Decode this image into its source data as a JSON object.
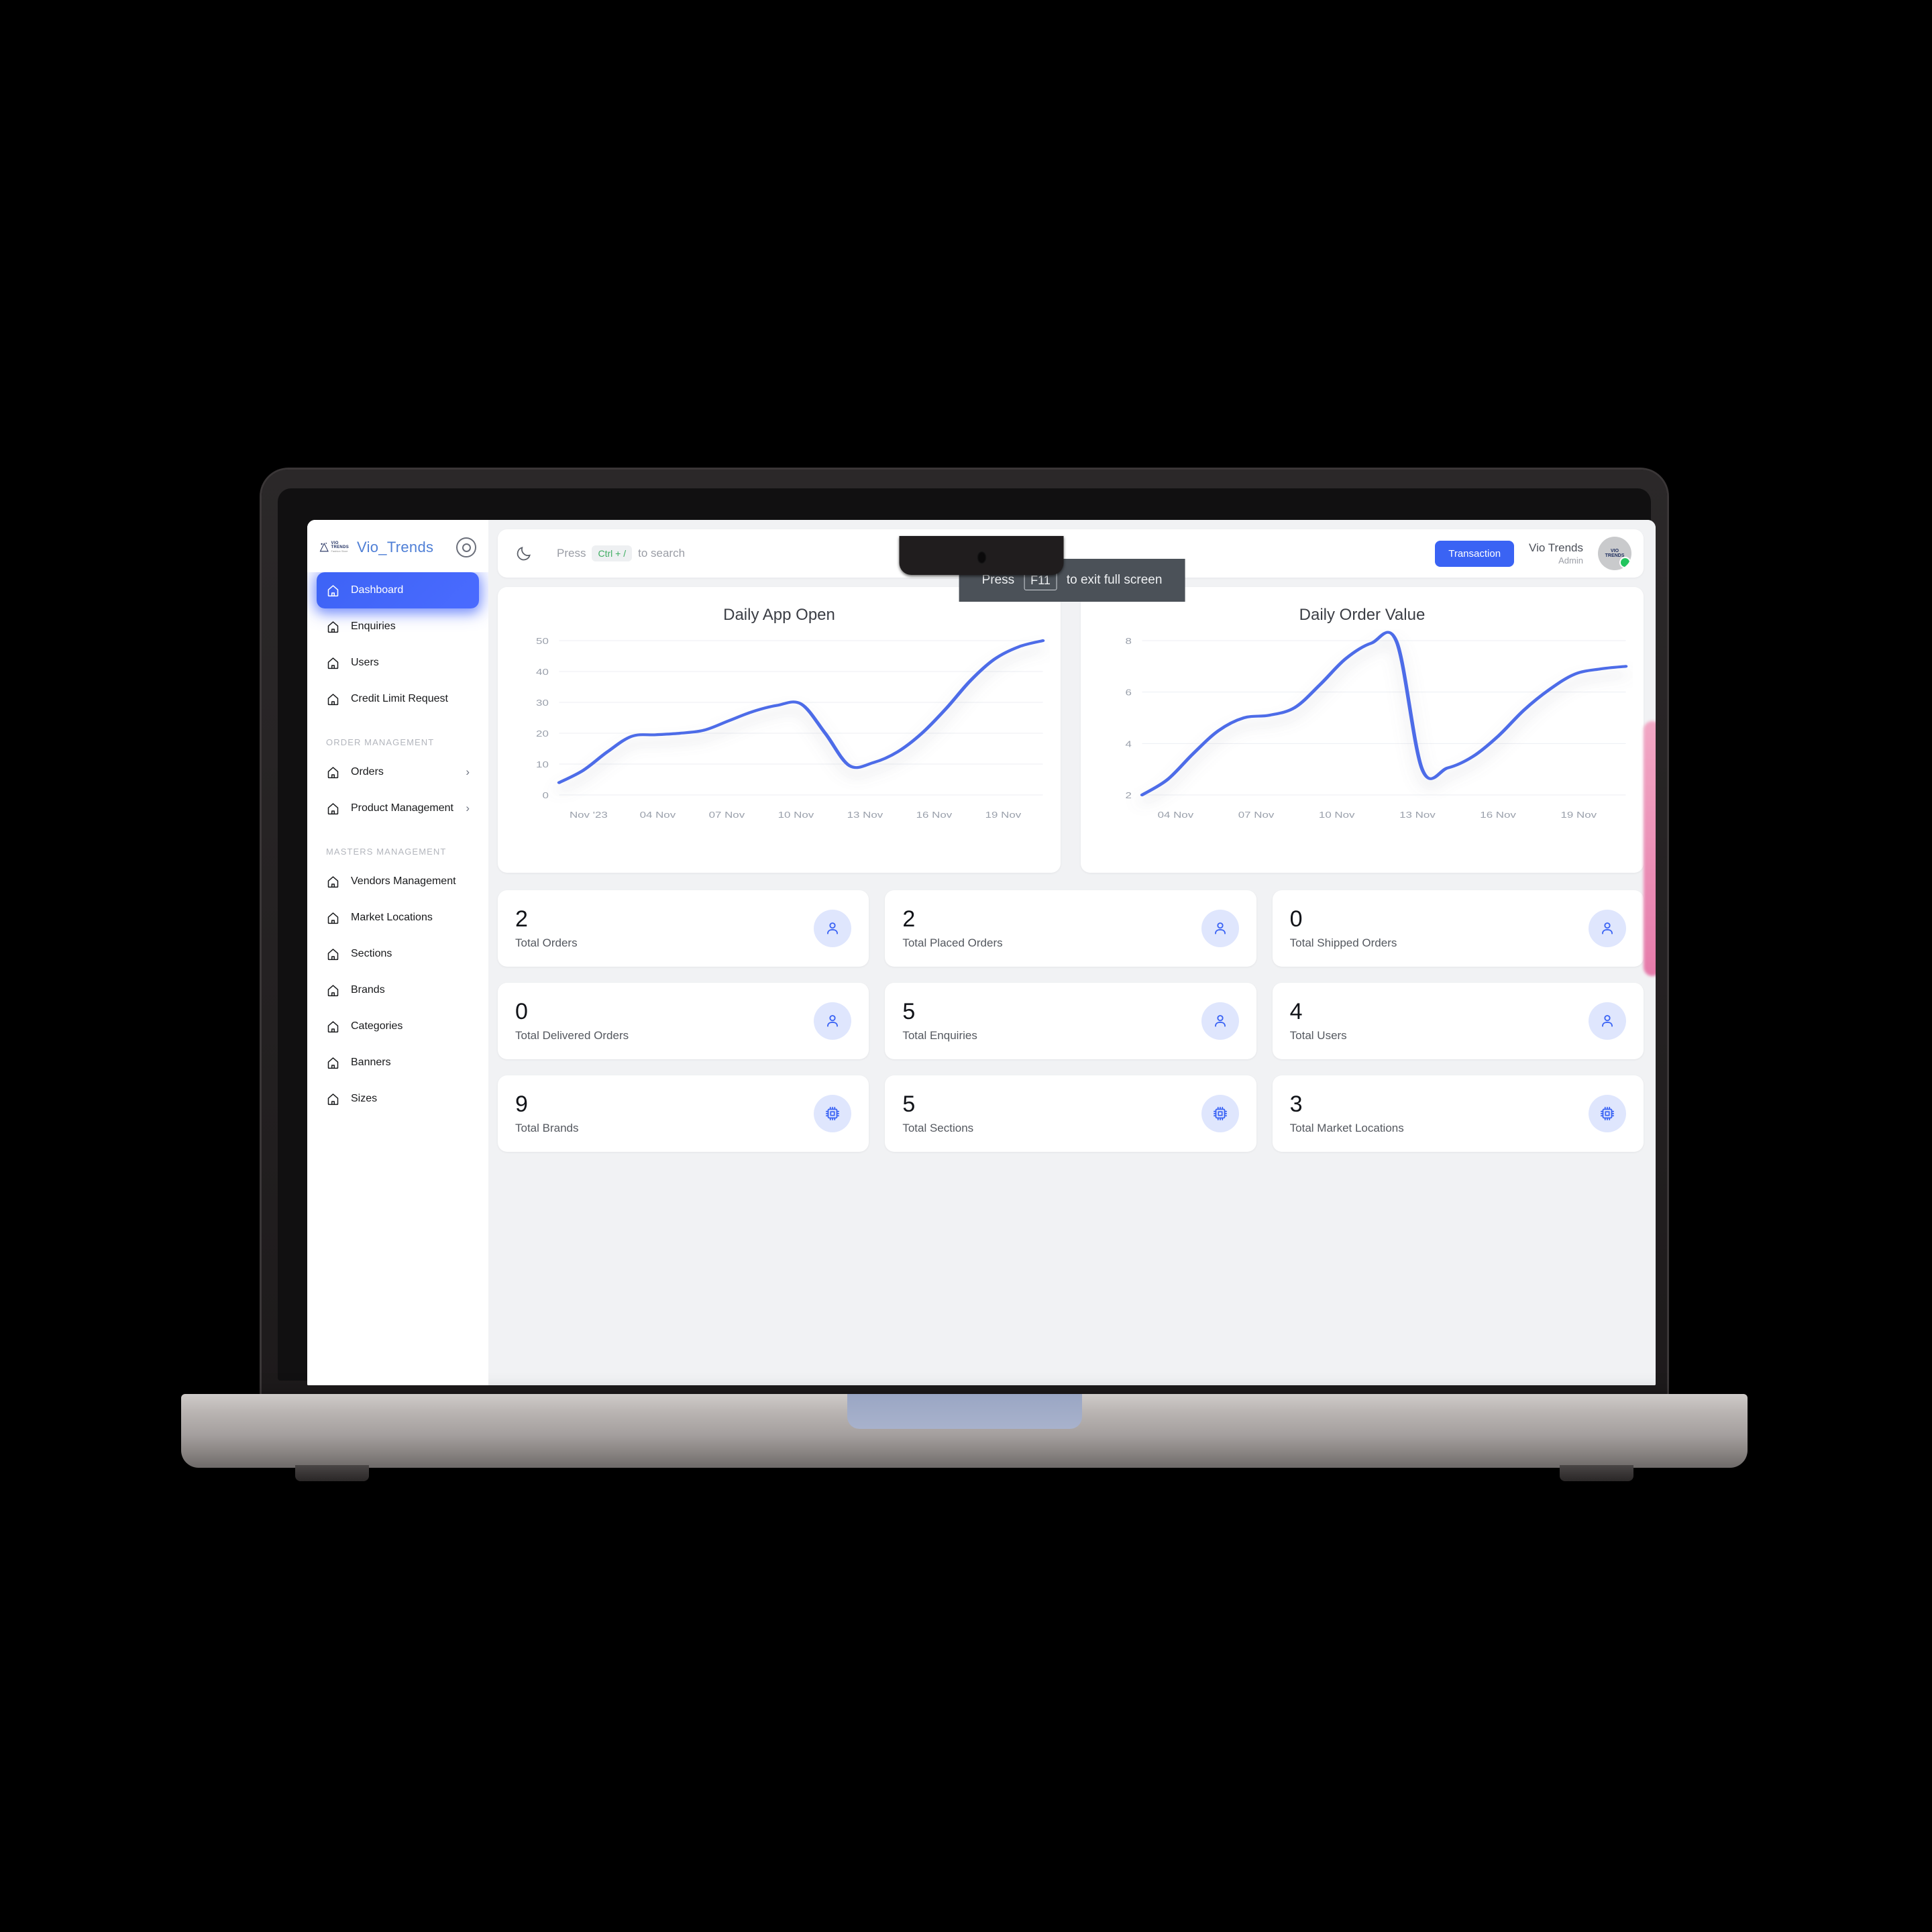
{
  "brand": {
    "name": "Vio_Trends",
    "logo_line1": "VIO",
    "logo_line2": "TRENDS",
    "logo_tagline": "Fashion Store",
    "target_icon": "target-icon"
  },
  "sidebar": {
    "items": [
      {
        "label": "Dashboard",
        "icon": "home-icon",
        "active": true,
        "chevron": ""
      },
      {
        "label": "Enquiries",
        "icon": "home-icon",
        "active": false,
        "chevron": ""
      },
      {
        "label": "Users",
        "icon": "home-icon",
        "active": false,
        "chevron": ""
      },
      {
        "label": "Credit Limit Request",
        "icon": "home-icon",
        "active": false,
        "chevron": ""
      }
    ],
    "section_order": {
      "title": "ORDER MANAGEMENT",
      "items": [
        {
          "label": "Orders",
          "icon": "home-icon",
          "chevron": "›"
        },
        {
          "label": "Product Management",
          "icon": "home-icon",
          "chevron": "›"
        }
      ]
    },
    "section_masters": {
      "title": "MASTERS MANAGEMENT",
      "items": [
        {
          "label": "Vendors Management",
          "icon": "home-icon",
          "chevron": ""
        },
        {
          "label": "Market Locations",
          "icon": "home-icon",
          "chevron": ""
        },
        {
          "label": "Sections",
          "icon": "home-icon",
          "chevron": ""
        },
        {
          "label": "Brands",
          "icon": "home-icon",
          "chevron": ""
        },
        {
          "label": "Categories",
          "icon": "home-icon",
          "chevron": ""
        },
        {
          "label": "Banners",
          "icon": "home-icon",
          "chevron": ""
        },
        {
          "label": "Sizes",
          "icon": "home-icon",
          "chevron": ""
        }
      ]
    }
  },
  "topbar": {
    "theme_icon": "moon-icon",
    "search_prefix": "Press",
    "search_kbd": "Ctrl + /",
    "search_suffix": "to search",
    "transaction_label": "Transaction",
    "user_name": "Vio Trends",
    "user_role": "Admin",
    "avatar_icon": "avatar",
    "status_dot_color": "#22c55e"
  },
  "fullscreen_toast": {
    "prefix": "Press",
    "key": "F11",
    "suffix": "to exit full screen"
  },
  "chart_data": [
    {
      "type": "line",
      "title": "Daily App Open",
      "xlabel": "",
      "ylabel": "",
      "ylim": [
        0,
        50
      ],
      "yticks": [
        0,
        10,
        20,
        30,
        40,
        50
      ],
      "xtick_labels": [
        "Nov '23",
        "04 Nov",
        "07 Nov",
        "10 Nov",
        "13 Nov",
        "16 Nov",
        "19 Nov"
      ],
      "grid": true,
      "legend": "none",
      "series": [
        {
          "name": "Daily App Open",
          "color": "#4e6ce8",
          "x": [
            "01 Nov",
            "02 Nov",
            "03 Nov",
            "04 Nov",
            "05 Nov",
            "06 Nov",
            "07 Nov",
            "08 Nov",
            "09 Nov",
            "10 Nov",
            "11 Nov",
            "12 Nov",
            "13 Nov",
            "14 Nov",
            "15 Nov",
            "16 Nov",
            "17 Nov",
            "18 Nov",
            "19 Nov",
            "20 Nov",
            "21 Nov"
          ],
          "values": [
            4,
            8,
            14,
            19,
            19.5,
            20,
            21,
            24,
            27,
            29,
            29.5,
            20,
            9.5,
            10.5,
            14,
            20,
            28,
            37,
            44,
            48,
            50
          ]
        }
      ]
    },
    {
      "type": "line",
      "title": "Daily Order Value",
      "xlabel": "",
      "ylabel": "",
      "ylim": [
        2,
        8
      ],
      "yticks": [
        2,
        4,
        6,
        8
      ],
      "xtick_labels": [
        "04 Nov",
        "07 Nov",
        "10 Nov",
        "13 Nov",
        "16 Nov",
        "19 Nov"
      ],
      "grid": true,
      "legend": "none",
      "series": [
        {
          "name": "Daily Order Value",
          "color": "#4e6ce8",
          "x": [
            "02 Nov",
            "03 Nov",
            "04 Nov",
            "05 Nov",
            "06 Nov",
            "07 Nov",
            "08 Nov",
            "09 Nov",
            "10 Nov",
            "11 Nov",
            "12 Nov",
            "13 Nov",
            "14 Nov",
            "15 Nov",
            "16 Nov",
            "17 Nov",
            "18 Nov",
            "19 Nov",
            "20 Nov",
            "21 Nov"
          ],
          "values": [
            2,
            2.6,
            3.6,
            4.5,
            5.0,
            5.1,
            5.4,
            6.3,
            7.3,
            7.9,
            7.95,
            3.0,
            3.05,
            3.5,
            4.3,
            5.3,
            6.1,
            6.7,
            6.9,
            7.0
          ]
        }
      ]
    }
  ],
  "stats": [
    {
      "value": "2",
      "label": "Total Orders",
      "icon": "user-icon"
    },
    {
      "value": "2",
      "label": "Total Placed Orders",
      "icon": "user-icon"
    },
    {
      "value": "0",
      "label": "Total Shipped Orders",
      "icon": "user-icon"
    },
    {
      "value": "0",
      "label": "Total Delivered Orders",
      "icon": "user-icon"
    },
    {
      "value": "5",
      "label": "Total Enquiries",
      "icon": "user-icon"
    },
    {
      "value": "4",
      "label": "Total Users",
      "icon": "user-icon"
    },
    {
      "value": "9",
      "label": "Total Brands",
      "icon": "chip-icon"
    },
    {
      "value": "5",
      "label": "Total Sections",
      "icon": "chip-icon"
    },
    {
      "value": "3",
      "label": "Total Market Locations",
      "icon": "chip-icon"
    }
  ],
  "colors": {
    "accent": "#3a63f4",
    "active_nav": "#4a6bff",
    "chart_line": "#4e6ce8",
    "page_bg": "#f1f2f4",
    "scrollbar": "#e56fa3",
    "toast_bg": "#4b5158"
  }
}
